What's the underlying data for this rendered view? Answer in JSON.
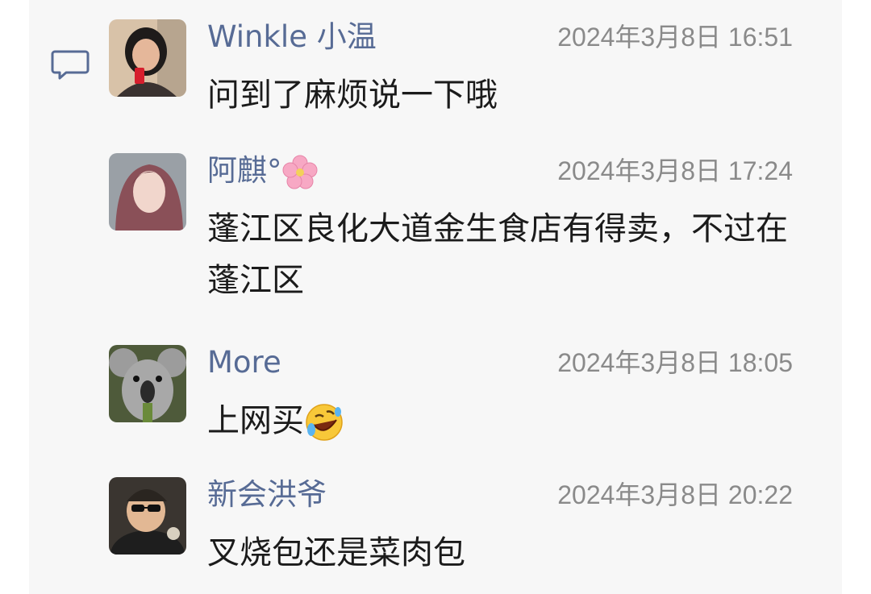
{
  "comments": [
    {
      "name": "Winkle 小温",
      "time": "2024年3月8日 16:51",
      "text": "问到了麻烦说一下哦",
      "avatar": "woman-selfie-avatar"
    },
    {
      "name": "阿麒°",
      "name_emoji": "cherry-blossom-emoji",
      "time": "2024年3月8日 17:24",
      "text": "蓬江区良化大道金生食店有得卖，不过在蓬江区",
      "avatar": "girl-pink-hair-avatar"
    },
    {
      "name": "More",
      "time": "2024年3月8日 18:05",
      "text": "上网买",
      "text_emoji": "rolling-on-floor-laughing-emoji",
      "avatar": "koala-avatar"
    },
    {
      "name": "新会洪爷",
      "time": "2024年3月8日 20:22",
      "text": "叉烧包还是菜肉包",
      "avatar": "cartoon-man-sunglasses-avatar"
    }
  ],
  "colors": {
    "name": "#576b95",
    "time": "#8a8a8a",
    "text": "#1b1b1b",
    "panel": "#f7f7f7"
  }
}
